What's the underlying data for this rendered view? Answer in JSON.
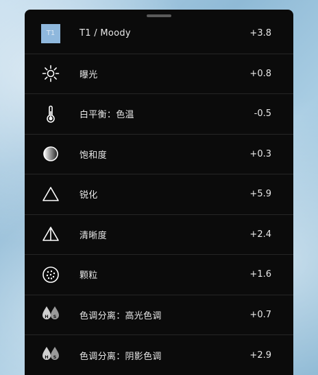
{
  "panel": {
    "rows": [
      {
        "label": "T1 / Moody",
        "value": "+3.8",
        "icon": "preset-thumbnail-icon",
        "thumb_text": "T1"
      },
      {
        "label": "曝光",
        "value": "+0.8",
        "icon": "sun-icon"
      },
      {
        "label": "白平衡：色温",
        "value": "-0.5",
        "icon": "thermometer-icon"
      },
      {
        "label": "饱和度",
        "value": "+0.3",
        "icon": "saturation-icon"
      },
      {
        "label": "锐化",
        "value": "+5.9",
        "icon": "triangle-icon"
      },
      {
        "label": "清晰度",
        "value": "+2.4",
        "icon": "clarity-triangle-icon"
      },
      {
        "label": "颗粒",
        "value": "+1.6",
        "icon": "grain-icon"
      },
      {
        "label": "色调分离：高光色调",
        "value": "+0.7",
        "icon": "split-tone-icon",
        "icon_letters": [
          "H",
          "S"
        ]
      },
      {
        "label": "色调分离：阴影色调",
        "value": "+2.9",
        "icon": "split-tone-icon",
        "icon_letters": [
          "H",
          "S"
        ]
      }
    ]
  },
  "colors": {
    "panel_bg": "#0b0b0b",
    "text": "#e8e8e8",
    "thumb": "#8fb8dd"
  }
}
